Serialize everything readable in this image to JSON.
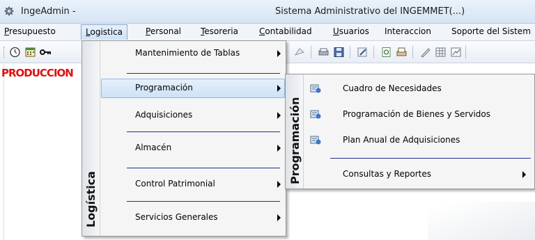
{
  "window": {
    "app_title": "IngeAdmin -",
    "window_title": "Sistema Administrativo del INGEMMET(...)",
    "app_icon": "gear-icon"
  },
  "menubar": {
    "items": [
      {
        "mnemonic": "P",
        "rest": "resupuesto",
        "label": "Presupuesto"
      },
      {
        "mnemonic": "L",
        "rest": "ogistica",
        "label": "Logistica",
        "active": true
      },
      {
        "mnemonic": "P",
        "rest": "ersonal",
        "label": "Personal",
        "pre": ""
      },
      {
        "mnemonic": "T",
        "rest": "esoreria",
        "label": "Tesoreria"
      },
      {
        "mnemonic": "C",
        "rest": "ontabilidad",
        "label": "Contabilidad"
      },
      {
        "mnemonic": "U",
        "rest": "suarios",
        "label": "Usuarios"
      },
      {
        "mnemonic": "",
        "rest": "Interaccion",
        "label": "Interaccion"
      },
      {
        "mnemonic": "",
        "rest": "Soporte del Sistem",
        "label": "Soporte del Sistem"
      }
    ]
  },
  "toolbar": {
    "icons": [
      "clock-icon",
      "calendar-icon",
      "key-icon",
      "document-icon",
      "printer-icon",
      "save-icon",
      "edit-icon",
      "report-icon",
      "print-icon",
      "pen-icon",
      "grid-icon",
      "chart-icon"
    ]
  },
  "workspace": {
    "production_label": "PRODUCCION"
  },
  "logistica_menu": {
    "band_title": "Logística",
    "items": [
      {
        "label": "Mantenimiento de Tablas",
        "has_submenu": true
      },
      {
        "label": "Programación",
        "has_submenu": true,
        "highlighted": true
      },
      {
        "label": "Adquisiciones",
        "has_submenu": true
      },
      {
        "label": "Almacén",
        "has_submenu": true
      },
      {
        "label": "Control Patrimonial",
        "has_submenu": true
      },
      {
        "label": "Servicios Generales",
        "has_submenu": true
      }
    ]
  },
  "programacion_menu": {
    "band_title": "Programación",
    "items": [
      {
        "label": "Cuadro de Necesidades",
        "icon": "form-icon",
        "has_submenu": false
      },
      {
        "label": "Programación de Bienes y Servidos",
        "icon": "form-icon",
        "has_submenu": false
      },
      {
        "label": "Plan Anual de Adquisiciones",
        "icon": "form-icon",
        "has_submenu": false
      },
      {
        "label": "Consultas y Reportes",
        "icon": "",
        "has_submenu": true
      }
    ]
  },
  "colors": {
    "production_text": "#e01010",
    "separator": "#1f2f8b",
    "highlight": "#cde2f7"
  }
}
